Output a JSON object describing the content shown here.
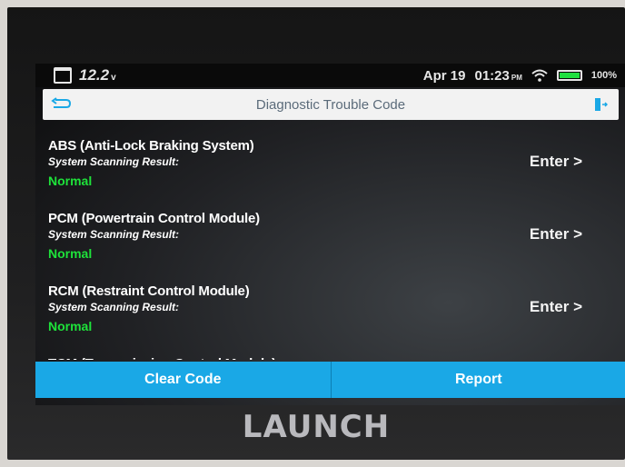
{
  "status": {
    "voltage": "12.2",
    "voltage_unit": "v",
    "date": "Apr 19",
    "time": "01:23",
    "time_suffix": "PM",
    "battery": "100%"
  },
  "header": {
    "title": "Diagnostic Trouble Code"
  },
  "modules": [
    {
      "name": "ABS (Anti-Lock Braking System)",
      "scan_label": "System Scanning Result:",
      "result": "Normal",
      "enter": "Enter >"
    },
    {
      "name": "PCM (Powertrain Control Module)",
      "scan_label": "System Scanning Result:",
      "result": "Normal",
      "enter": "Enter >"
    },
    {
      "name": "RCM (Restraint Control Module)",
      "scan_label": "System Scanning Result:",
      "result": "Normal",
      "enter": "Enter >"
    },
    {
      "name": "TCM (Transmission Control Module)"
    }
  ],
  "actions": {
    "clear_code": "Clear Code",
    "report": "Report"
  },
  "brand": "LAUNCH",
  "colors": {
    "accent": "#1aa8e6",
    "normal": "#1ee23a"
  }
}
